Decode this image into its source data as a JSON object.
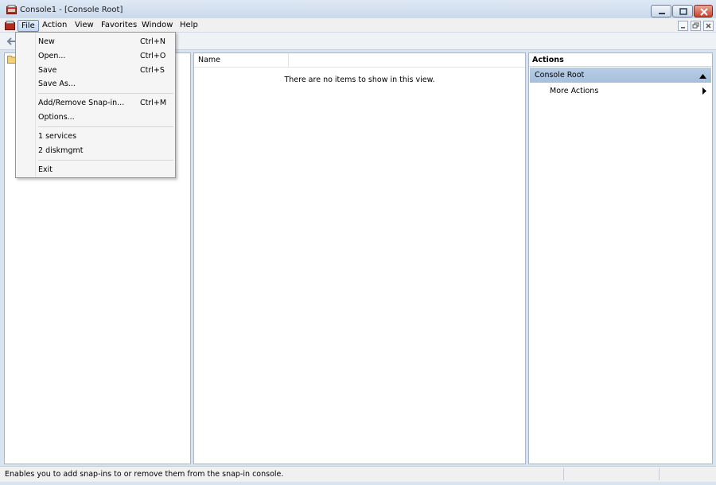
{
  "window": {
    "title": "Console1 - [Console Root]"
  },
  "menubar": {
    "file": "File",
    "action": "Action",
    "view": "View",
    "favorites": "Favorites",
    "window": "Window",
    "help": "Help"
  },
  "file_menu": {
    "new": {
      "label": "New",
      "shortcut": "Ctrl+N"
    },
    "open": {
      "label": "Open...",
      "shortcut": "Ctrl+O"
    },
    "save": {
      "label": "Save",
      "shortcut": "Ctrl+S"
    },
    "save_as": {
      "label": "Save As..."
    },
    "add_remove": {
      "label": "Add/Remove Snap-in...",
      "shortcut": "Ctrl+M"
    },
    "options": {
      "label": "Options..."
    },
    "recent1": {
      "label": "1 services"
    },
    "recent2": {
      "label": "2 diskmgmt"
    },
    "exit": {
      "label": "Exit"
    }
  },
  "center": {
    "column_name": "Name",
    "empty_message": "There are no items to show in this view."
  },
  "actions": {
    "header": "Actions",
    "section_title": "Console Root",
    "more_actions": "More Actions"
  },
  "statusbar": {
    "text": "Enables you to add snap-ins to or remove them from the snap-in console."
  },
  "colors": {
    "section_bg": "#b3c9e3",
    "close_button": "#c8442c"
  }
}
